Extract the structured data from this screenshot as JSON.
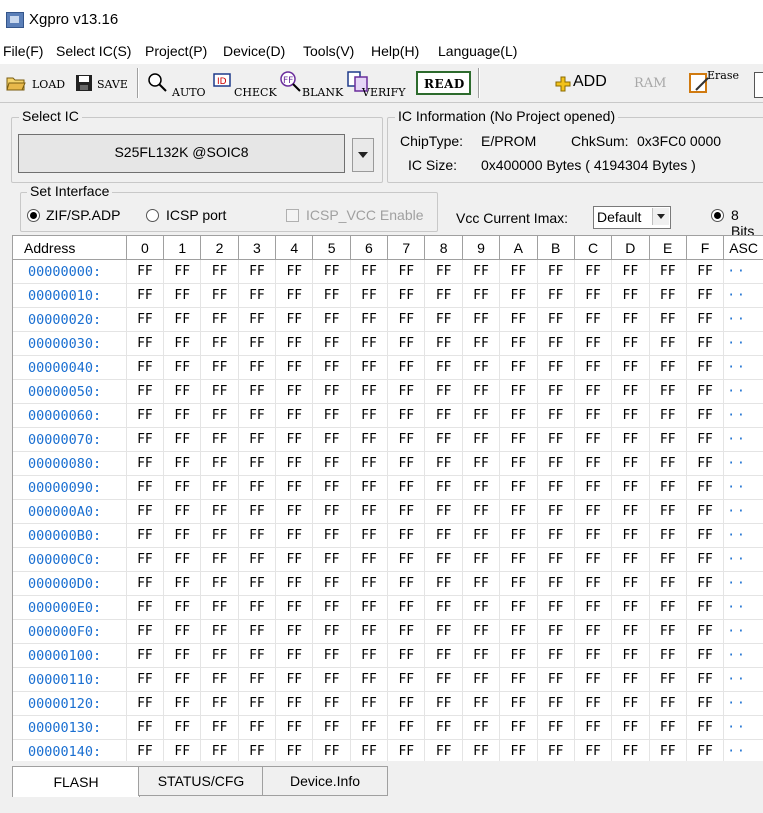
{
  "window": {
    "title": "Xgpro v13.16"
  },
  "menu": [
    "File(F)",
    "Select IC(S)",
    "Project(P)",
    "Device(D)",
    "Tools(V)",
    "Help(H)",
    "Language(L)"
  ],
  "toolbar": {
    "load": "LOAD",
    "save": "SAVE",
    "auto": "AUTO",
    "check": "CHECK",
    "blank": "BLANK",
    "verify": "VERIFY",
    "read": "READ",
    "add": "ADD",
    "ram": "RAM",
    "erase": "Erase"
  },
  "select_ic": {
    "title": "Select IC",
    "value": "S25FL132K @SOIC8"
  },
  "ic_info": {
    "title": "IC Information (No Project opened)",
    "chip_type_label": "ChipType:",
    "chip_type": "E/PROM",
    "chksum_label": "ChkSum:",
    "chksum": "0x3FC0 0000",
    "ic_size_label": "IC Size:",
    "ic_size": "0x400000 Bytes ( 4194304 Bytes )"
  },
  "interface": {
    "title": "Set Interface",
    "zif": "ZIF/SP.ADP",
    "icsp": "ICSP port",
    "icsp_vcc": "ICSP_VCC Enable",
    "selected": "ZIF/SP.ADP"
  },
  "vcc": {
    "label": "Vcc Current Imax:",
    "value": "Default"
  },
  "bits": {
    "label": "8 Bits"
  },
  "hex": {
    "address_header": "Address",
    "columns": [
      "0",
      "1",
      "2",
      "3",
      "4",
      "5",
      "6",
      "7",
      "8",
      "9",
      "A",
      "B",
      "C",
      "D",
      "E",
      "F"
    ],
    "ascii_header": "ASC",
    "rows": [
      {
        "addr": "00000000:",
        "fill": "FF",
        "ascii": "··"
      },
      {
        "addr": "00000010:",
        "fill": "FF",
        "ascii": "··"
      },
      {
        "addr": "00000020:",
        "fill": "FF",
        "ascii": "··"
      },
      {
        "addr": "00000030:",
        "fill": "FF",
        "ascii": "··"
      },
      {
        "addr": "00000040:",
        "fill": "FF",
        "ascii": "··"
      },
      {
        "addr": "00000050:",
        "fill": "FF",
        "ascii": "··"
      },
      {
        "addr": "00000060:",
        "fill": "FF",
        "ascii": "··"
      },
      {
        "addr": "00000070:",
        "fill": "FF",
        "ascii": "··"
      },
      {
        "addr": "00000080:",
        "fill": "FF",
        "ascii": "··"
      },
      {
        "addr": "00000090:",
        "fill": "FF",
        "ascii": "··"
      },
      {
        "addr": "000000A0:",
        "fill": "FF",
        "ascii": "··"
      },
      {
        "addr": "000000B0:",
        "fill": "FF",
        "ascii": "··"
      },
      {
        "addr": "000000C0:",
        "fill": "FF",
        "ascii": "··"
      },
      {
        "addr": "000000D0:",
        "fill": "FF",
        "ascii": "··"
      },
      {
        "addr": "000000E0:",
        "fill": "FF",
        "ascii": "··"
      },
      {
        "addr": "000000F0:",
        "fill": "FF",
        "ascii": "··"
      },
      {
        "addr": "00000100:",
        "fill": "FF",
        "ascii": "··"
      },
      {
        "addr": "00000110:",
        "fill": "FF",
        "ascii": "··"
      },
      {
        "addr": "00000120:",
        "fill": "FF",
        "ascii": "··"
      },
      {
        "addr": "00000130:",
        "fill": "FF",
        "ascii": "··"
      },
      {
        "addr": "00000140:",
        "fill": "FF",
        "ascii": "··"
      }
    ]
  },
  "tabs": [
    "FLASH",
    "STATUS/CFG",
    "Device.Info"
  ],
  "active_tab": "FLASH",
  "colors": {
    "address_blue": "#1a6fd1",
    "add_icon": "#e8b400",
    "read_border": "#2d6b2d"
  }
}
